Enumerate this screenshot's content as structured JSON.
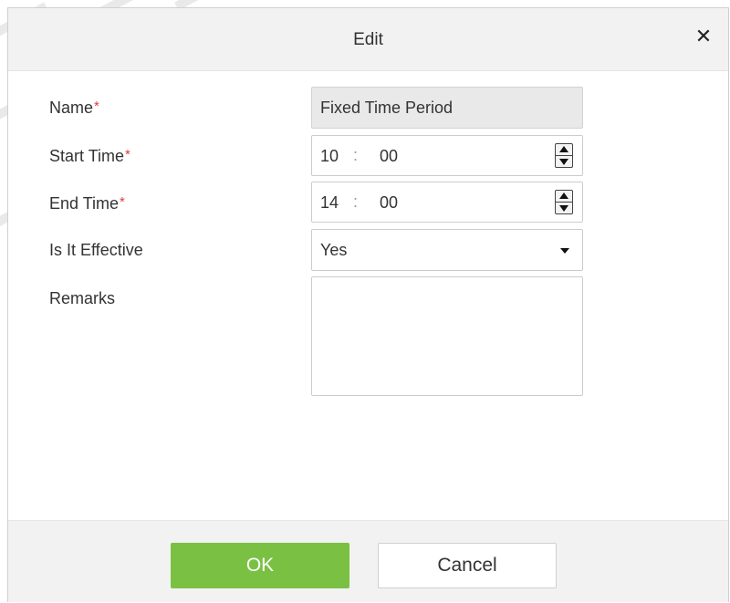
{
  "dialog": {
    "title": "Edit",
    "close_icon": "close-icon"
  },
  "form": {
    "name": {
      "label": "Name",
      "required_mark": "*",
      "value": "Fixed Time Period"
    },
    "start_time": {
      "label": "Start Time",
      "required_mark": "*",
      "hour": "10",
      "separator": ":",
      "minute": "00"
    },
    "end_time": {
      "label": "End Time",
      "required_mark": "*",
      "hour": "14",
      "separator": ":",
      "minute": "00"
    },
    "is_effective": {
      "label": "Is It Effective",
      "value": "Yes"
    },
    "remarks": {
      "label": "Remarks",
      "value": ""
    }
  },
  "footer": {
    "ok_label": "OK",
    "cancel_label": "Cancel"
  },
  "colors": {
    "ok_button": "#7ac143",
    "required": "#e23b3b",
    "header_bg": "#f2f2f2"
  }
}
